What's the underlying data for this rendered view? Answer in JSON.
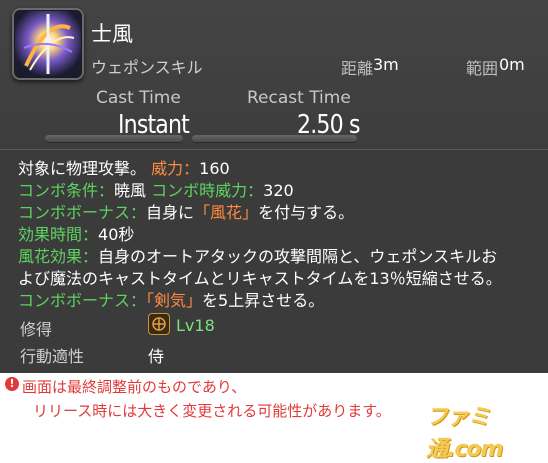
{
  "skill": {
    "name": "士風",
    "type": "ウェポンスキル",
    "icon": "shifu-skill-icon",
    "distance_label": "距離",
    "distance_value": "3m",
    "range_label": "範囲",
    "range_value": "0m"
  },
  "timing": {
    "cast_label": "Cast Time",
    "cast_value": "Instant",
    "recast_label": "Recast Time",
    "recast_value": "2.50 s"
  },
  "description": {
    "line1": {
      "text": "対象に物理攻撃。",
      "potency_label": "威力",
      "potency_sep": "：",
      "potency_value": "160"
    },
    "line2": {
      "combo_cond_label": "コンボ条件",
      "sep1": "：",
      "combo_cond_value": "暁風",
      "combo_pot_label": "コンボ時威力",
      "sep2": "：",
      "combo_pot_value": "320"
    },
    "line3": {
      "bonus_label": "コンボボーナス",
      "sep": "：",
      "pre": "自身に",
      "status": "「風花」",
      "post": "を付与する。"
    },
    "line4": {
      "duration_label": "効果時間",
      "sep": "：",
      "duration_value": "40秒"
    },
    "line5": {
      "effect_label": "風花効果",
      "sep": "：",
      "text": "自身のオートアタックの攻撃間隔と、ウェポンスキルお"
    },
    "line6": {
      "text": "よび魔法のキャストタイムとリキャストタイムを13％短縮させる。"
    },
    "line7": {
      "bonus_label": "コンボボーナス",
      "sep": "：",
      "status": "「剣気」",
      "post": "を5上昇させる。"
    }
  },
  "meta": {
    "acquire_label": "修得",
    "class_icon": "samurai-class-icon",
    "level": "Lv18",
    "affinity_label": "行動適性",
    "job": "侍"
  },
  "notice": {
    "icon": "warning-icon",
    "line1": "画面は最終調整前のものであり、",
    "line2": "リリース時には大きく変更される可能性があります。"
  },
  "watermark": "ファミ通.com",
  "colors": {
    "label_green": "#5fd35f",
    "status_orange": "#ff8a3d",
    "notice_red": "#e23a3a",
    "tooltip_bg": "#3b3b3b"
  }
}
